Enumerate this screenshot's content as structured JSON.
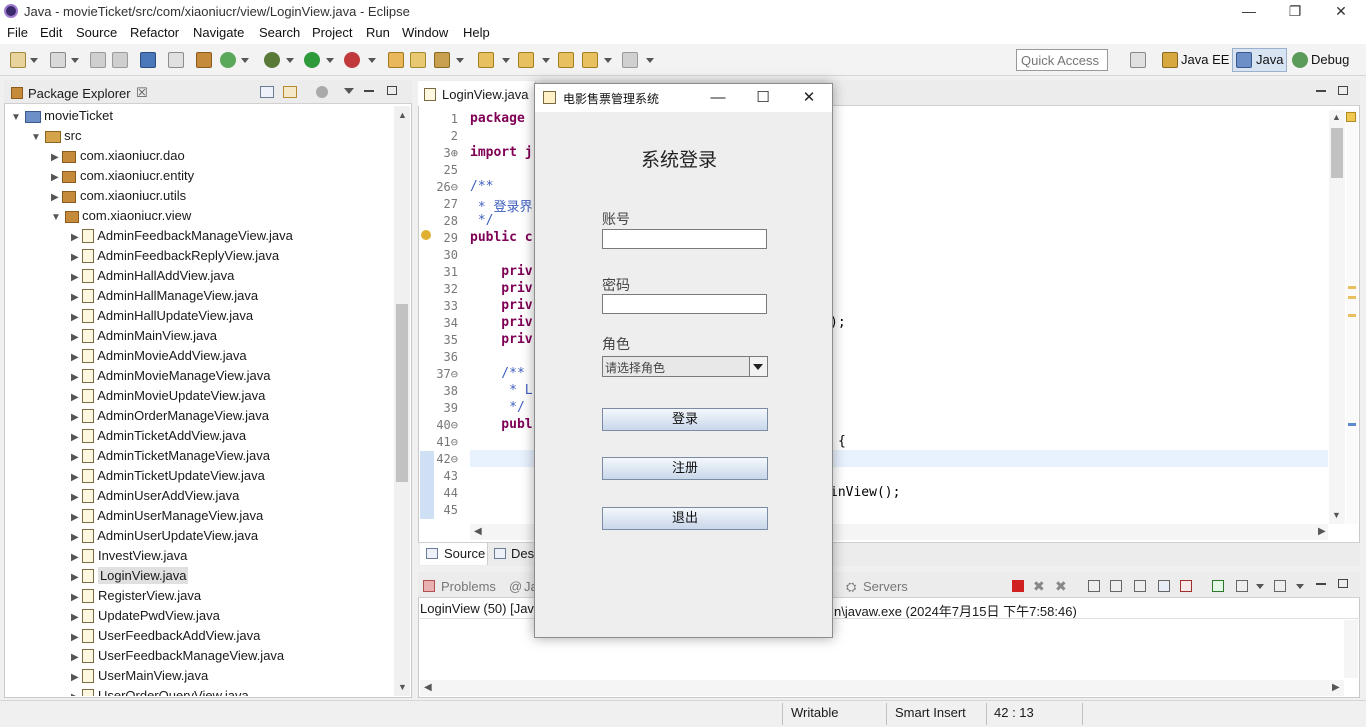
{
  "window": {
    "title": "Java - movieTicket/src/com/xiaoniucr/view/LoginView.java - Eclipse",
    "minimize_glyph": "—",
    "restore_glyph": "❐",
    "close_glyph": "✕"
  },
  "menu": [
    "File",
    "Edit",
    "Source",
    "Refactor",
    "Navigate",
    "Search",
    "Project",
    "Run",
    "Window",
    "Help"
  ],
  "toolbar": {
    "quick_access_placeholder": "Quick Access",
    "perspectives": [
      "Java EE",
      "Java",
      "Debug"
    ]
  },
  "package_explorer": {
    "title": "Package Explorer",
    "close_glyph": "☒",
    "project": "movieTicket",
    "src": "src",
    "packages": [
      "com.xiaoniucr.dao",
      "com.xiaoniucr.entity",
      "com.xiaoniucr.utils",
      "com.xiaoniucr.view"
    ],
    "files": [
      "AdminFeedbackManageView.java",
      "AdminFeedbackReplyView.java",
      "AdminHallAddView.java",
      "AdminHallManageView.java",
      "AdminHallUpdateView.java",
      "AdminMainView.java",
      "AdminMovieAddView.java",
      "AdminMovieManageView.java",
      "AdminMovieUpdateView.java",
      "AdminOrderManageView.java",
      "AdminTicketAddView.java",
      "AdminTicketManageView.java",
      "AdminTicketUpdateView.java",
      "AdminUserAddView.java",
      "AdminUserManageView.java",
      "AdminUserUpdateView.java",
      "InvestView.java",
      "LoginView.java",
      "RegisterView.java",
      "UpdatePwdView.java",
      "UserFeedbackAddView.java",
      "UserFeedbackManageView.java",
      "UserMainView.java",
      "UserOrderQueryView.java"
    ],
    "selected_file": "LoginView.java"
  },
  "editor": {
    "tab_label": "LoginView.java",
    "lines": [
      {
        "n": "1",
        "text": "package",
        "kw": true
      },
      {
        "n": "2",
        "text": ""
      },
      {
        "n": "3⊕",
        "text": "import j",
        "kw": true
      },
      {
        "n": "25",
        "text": ""
      },
      {
        "n": "26⊖",
        "text": "/**",
        "cm": true
      },
      {
        "n": "27",
        "text": " * 登录界",
        "cm": true
      },
      {
        "n": "28",
        "text": " */",
        "cm": true
      },
      {
        "n": "29",
        "text": "public c",
        "kw": true
      },
      {
        "n": "30",
        "text": ""
      },
      {
        "n": "31",
        "text": "    priv",
        "kw": true
      },
      {
        "n": "32",
        "text": "    priv",
        "kw": true
      },
      {
        "n": "33",
        "text": "    priv",
        "kw": true
      },
      {
        "n": "34",
        "text": "    priv",
        "kw": true
      },
      {
        "n": "35",
        "text": "    priv",
        "kw": true
      },
      {
        "n": "36",
        "text": ""
      },
      {
        "n": "37⊖",
        "text": "    /**",
        "cm": true
      },
      {
        "n": "38",
        "text": "     * L",
        "cm": true
      },
      {
        "n": "39",
        "text": "     */",
        "cm": true
      },
      {
        "n": "40⊖",
        "text": "    publ",
        "kw": true
      },
      {
        "n": "41⊖",
        "text": ""
      },
      {
        "n": "42⊖",
        "text": ""
      },
      {
        "n": "43",
        "text": ""
      },
      {
        "n": "44",
        "text": ""
      },
      {
        "n": "45",
        "text": ""
      }
    ],
    "right_fragments": [
      {
        "line": "34",
        "text": ");"
      },
      {
        "line": "41",
        "text": "{"
      },
      {
        "line": "44",
        "text": "inView();"
      }
    ],
    "bottom_tabs": [
      "Source",
      "Des"
    ]
  },
  "console": {
    "tabs": [
      "Problems",
      "Ja",
      "Servers"
    ],
    "output_left": "LoginView (50) [Java",
    "output_right": "n\\javaw.exe (2024年7月15日 下午7:58:46)"
  },
  "status": {
    "writable": "Writable",
    "insert_mode": "Smart Insert",
    "position": "42 : 13"
  },
  "dialog": {
    "title": "电影售票管理系统",
    "heading": "系统登录",
    "account_label": "账号",
    "account_value": "",
    "password_label": "密码",
    "password_value": "",
    "role_label": "角色",
    "role_selected": "请选择角色",
    "login_button": "登录",
    "register_button": "注册",
    "exit_button": "退出",
    "minimize_glyph": "—",
    "maximize_glyph": "☐",
    "close_glyph": "✕"
  },
  "colors": {
    "keyword": "#7f0055",
    "comment": "#3f5fbf",
    "current_line": "#e8f2fe",
    "button_gradient_top": "#f4f8fc",
    "button_gradient_bottom": "#c8d7ea"
  }
}
